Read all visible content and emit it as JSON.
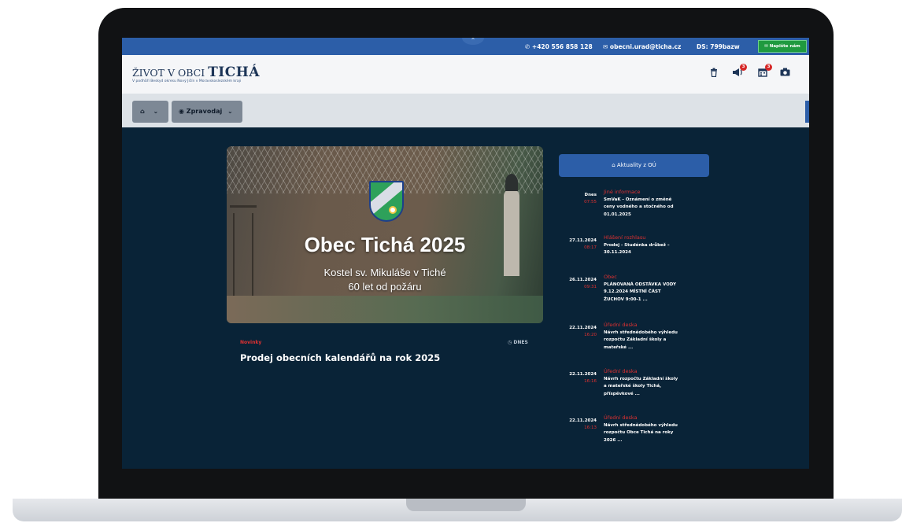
{
  "topbar": {
    "phone": "+420 556 858 128",
    "email": "obecni.urad@ticha.cz",
    "ds": "DS: 799bazw",
    "write_label": "Napište nám",
    "collapse_glyph": "⌃"
  },
  "header": {
    "title_prefix": "ŽIVOT V OBCI",
    "title_main": "TICHÁ",
    "subtitle": "V podhůří Beskyd okresu Nový Jičín v Moravskoslezském kraji",
    "icons": [
      "trash-icon",
      "megaphone-icon",
      "calendar-icon",
      "camera-icon"
    ],
    "badge_megaphone": "3",
    "badge_calendar": "3"
  },
  "nav": {
    "home_label": "",
    "zpravodaj_label": "Zpravodaj"
  },
  "hero": {
    "title": "Obec Tichá 2025",
    "sub1": "Kostel sv. Mikuláše v Tiché",
    "sub2": "60 let od požáru"
  },
  "news": {
    "category": "Novinky",
    "date": "DNES",
    "title": "Prodej obecních kalendářů na rok 2025"
  },
  "sidebar": {
    "button_label": "Aktuality z OÚ",
    "items": [
      {
        "date": "Dnes",
        "time": "07:55",
        "category": "Jiné informace",
        "lines": [
          "SmVaK - Oznámení o změně",
          "ceny vodného a stočného od",
          "01.01.2025"
        ]
      },
      {
        "date": "27.11.2024",
        "time": "08:17",
        "category": "Hlášení rozhlasu",
        "lines": [
          "Prodej - Studénka drůbež –",
          "30.11.2024"
        ]
      },
      {
        "date": "26.11.2024",
        "time": "09:31",
        "category": "Obec",
        "lines": [
          "PLÁNOVANÁ ODSTÁVKA VODY",
          "9.12.2024 MÍSTNÍ ČÁST",
          "ŽUCHOV 9:00-1 ..."
        ]
      },
      {
        "date": "22.11.2024",
        "time": "16:20",
        "category": "Úřední deska",
        "lines": [
          "Návrh střednědobého výhledu",
          "rozpočtu Základní školy a",
          "mateřské ..."
        ]
      },
      {
        "date": "22.11.2024",
        "time": "16:16",
        "category": "Úřední deska",
        "lines": [
          "Návrh rozpočtu Základní školy",
          "a mateřské školy Tichá,",
          "příspěvkové ..."
        ]
      },
      {
        "date": "22.11.2024",
        "time": "16:13",
        "category": "Úřední deska",
        "lines": [
          "Návrh střednědobého výhledu",
          "rozpočtu Obce Tichá na roky",
          "2026 ..."
        ]
      }
    ]
  },
  "colors": {
    "page_bg": "#092337",
    "accent_blue": "#2c5ea8",
    "accent_red": "#e03131",
    "accent_green": "#1f9a3f"
  }
}
